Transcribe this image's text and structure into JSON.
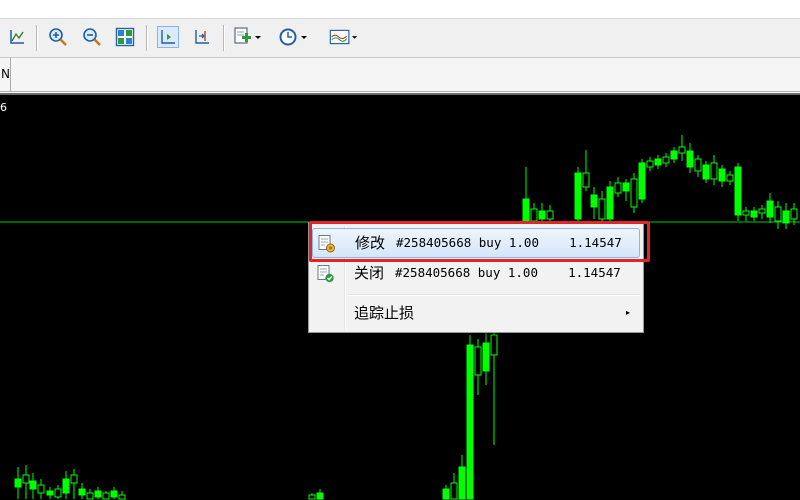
{
  "toolbar": {
    "buttons": [
      {
        "name": "line-studies-icon"
      },
      {
        "name": "zoom-in-icon"
      },
      {
        "name": "zoom-out-icon"
      },
      {
        "name": "tile-windows-icon"
      },
      {
        "name": "chart-shift-icon"
      },
      {
        "name": "autoscroll-icon"
      },
      {
        "name": "indicators-icon"
      },
      {
        "name": "periods-clock-icon"
      },
      {
        "name": "templates-icon"
      }
    ]
  },
  "subbar": {
    "tab_text": "N"
  },
  "chart": {
    "top_label": "6",
    "background": "#000000",
    "candle_color": "#00ff00",
    "bid_line_color": "#00c800"
  },
  "context_menu": {
    "items": [
      {
        "label": "修改",
        "detail": "#258405668 buy 1.00    1.14547",
        "icon": "modify-order-icon",
        "highlighted": true
      },
      {
        "label": "关闭",
        "detail": "#258405668 buy 1.00    1.14547",
        "icon": "close-order-icon"
      },
      {
        "label": "追踪止损",
        "detail": "",
        "icon": "",
        "submenu_arrow": "▸"
      }
    ]
  },
  "annotation": {
    "highlight_color": "#e0262b"
  }
}
